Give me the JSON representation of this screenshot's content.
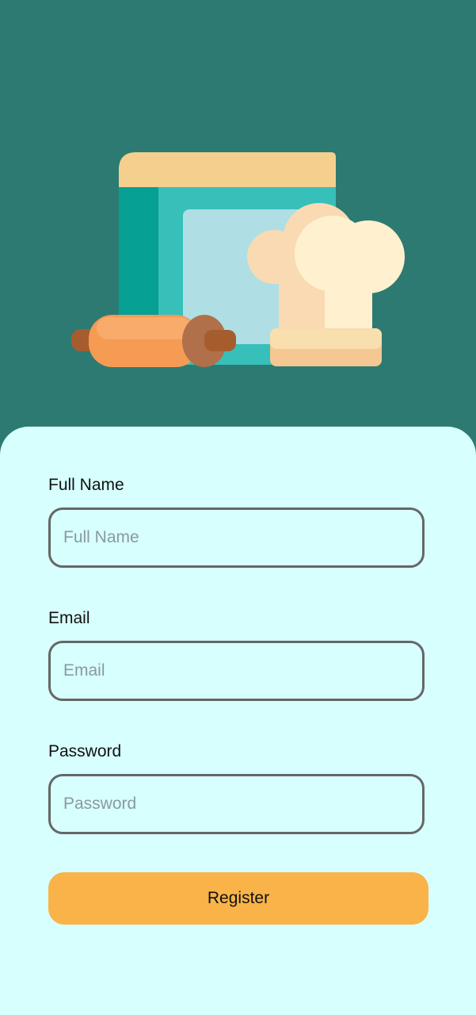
{
  "hero": {
    "illustration": "cookbook-chef-hat-rolling-pin-illustration"
  },
  "form": {
    "full_name": {
      "label": "Full Name",
      "placeholder": "Full Name",
      "value": ""
    },
    "email": {
      "label": "Email",
      "placeholder": "Email",
      "value": ""
    },
    "password": {
      "label": "Password",
      "placeholder": "Password",
      "value": ""
    },
    "register_label": "Register"
  },
  "colors": {
    "background": "#2d7a72",
    "card": "#d7fffe",
    "accent": "#f9b349",
    "field_border": "#666666"
  }
}
